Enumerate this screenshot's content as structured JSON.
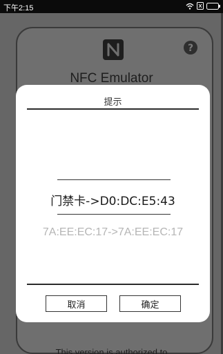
{
  "status_bar": {
    "time": "下午2:15",
    "icons": [
      "wifi-icon",
      "sim-icon",
      "battery-icon"
    ]
  },
  "app": {
    "title": "NFC Emulator",
    "footer": "This version is authorized to",
    "logo_icon": "nfc-logo-icon",
    "help_icon": "help-icon"
  },
  "dialog": {
    "title": "提示",
    "message": "门禁卡->D0:DC:E5:43",
    "submessage": "7A:EE:EC:17->7A:EE:EC:17",
    "cancel_label": "取消",
    "ok_label": "确定"
  },
  "colors": {
    "overlay": "#666666",
    "dialog_bg": "#ffffff",
    "submessage": "#b5b5b5"
  }
}
